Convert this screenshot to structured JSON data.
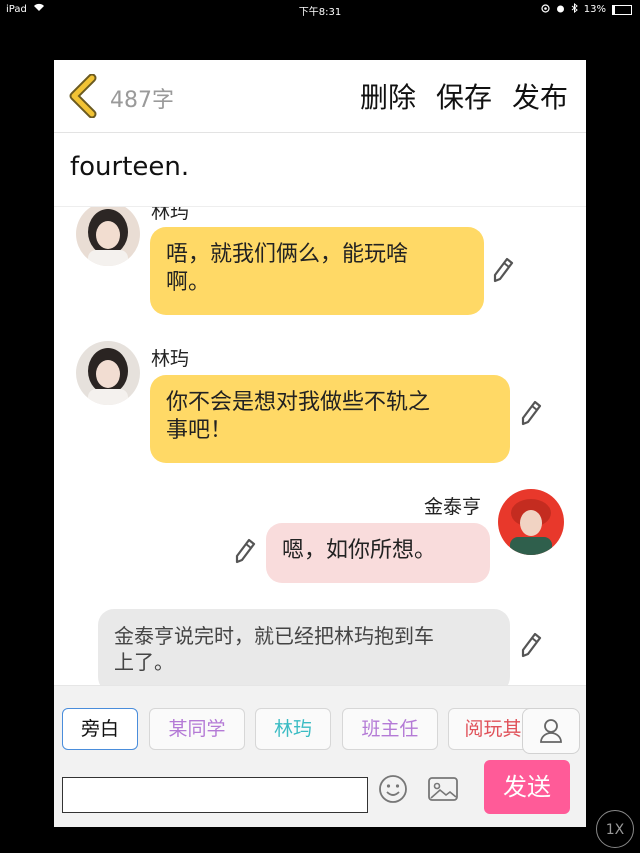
{
  "status_bar": {
    "device": "iPad",
    "time": "下午8:31",
    "battery": "13%",
    "battery_level": 0.13
  },
  "header": {
    "word_count": "487字",
    "actions": [
      "删除",
      "保存",
      "发布"
    ]
  },
  "doc_title": "fourteen.",
  "messages": [
    {
      "speaker": "林玙",
      "text": "唔，就我们俩么，能玩啥啊。",
      "lines": [
        "唔，就我们俩么，能玩啥",
        "啊。"
      ]
    },
    {
      "speaker": "林玙",
      "text": "你不会是想对我做些不轨之事吧！",
      "lines": [
        "你不会是想对我做些不轨之",
        "事吧！"
      ]
    },
    {
      "speaker": "金泰亨",
      "text": "嗯，如你所想。",
      "lines": [
        "嗯，如你所想。"
      ]
    },
    {
      "speaker": "",
      "text": "金泰亨说完时，就已经把林玙抱到车上了。",
      "lines": [
        "金泰亨说完时，就已经把林玙抱到车",
        "上了。"
      ]
    }
  ],
  "roles": [
    {
      "label": "旁白",
      "color": "#111111",
      "active": true
    },
    {
      "label": "某同学",
      "color": "#b47ad6",
      "active": false
    },
    {
      "label": "林玙",
      "color": "#3bbcc4",
      "active": false
    },
    {
      "label": "班主任",
      "color": "#b47ad6",
      "active": false
    },
    {
      "label": "阅玩其",
      "color": "#e0525a",
      "active": false
    }
  ],
  "send_label": "发送",
  "zoom_label": "1X",
  "colors": {
    "accent_yellow": "#ffd966",
    "bubble_pink": "#f9dcdc",
    "bubble_gray": "#e9e9e9",
    "send_pink": "#ff5b98",
    "back_arrow": "#f2c335"
  },
  "icons": [
    "back-chevron-icon",
    "pencil-icon",
    "emoji-icon",
    "image-icon",
    "person-icon",
    "wifi-icon",
    "bluetooth-icon",
    "alarm-icon",
    "location-icon"
  ]
}
